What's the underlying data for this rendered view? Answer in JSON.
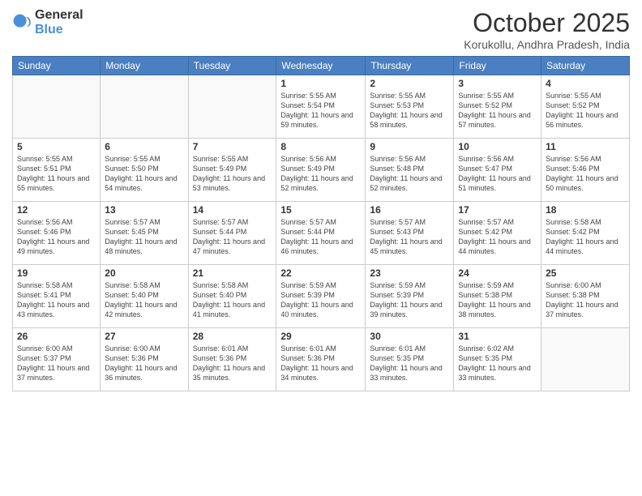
{
  "logo": {
    "general": "General",
    "blue": "Blue"
  },
  "title": "October 2025",
  "subtitle": "Korukollu, Andhra Pradesh, India",
  "weekdays": [
    "Sunday",
    "Monday",
    "Tuesday",
    "Wednesday",
    "Thursday",
    "Friday",
    "Saturday"
  ],
  "weeks": [
    [
      {
        "day": "",
        "info": ""
      },
      {
        "day": "",
        "info": ""
      },
      {
        "day": "",
        "info": ""
      },
      {
        "day": "1",
        "info": "Sunrise: 5:55 AM\nSunset: 5:54 PM\nDaylight: 11 hours\nand 59 minutes."
      },
      {
        "day": "2",
        "info": "Sunrise: 5:55 AM\nSunset: 5:53 PM\nDaylight: 11 hours\nand 58 minutes."
      },
      {
        "day": "3",
        "info": "Sunrise: 5:55 AM\nSunset: 5:52 PM\nDaylight: 11 hours\nand 57 minutes."
      },
      {
        "day": "4",
        "info": "Sunrise: 5:55 AM\nSunset: 5:52 PM\nDaylight: 11 hours\nand 56 minutes."
      }
    ],
    [
      {
        "day": "5",
        "info": "Sunrise: 5:55 AM\nSunset: 5:51 PM\nDaylight: 11 hours\nand 55 minutes."
      },
      {
        "day": "6",
        "info": "Sunrise: 5:55 AM\nSunset: 5:50 PM\nDaylight: 11 hours\nand 54 minutes."
      },
      {
        "day": "7",
        "info": "Sunrise: 5:55 AM\nSunset: 5:49 PM\nDaylight: 11 hours\nand 53 minutes."
      },
      {
        "day": "8",
        "info": "Sunrise: 5:56 AM\nSunset: 5:49 PM\nDaylight: 11 hours\nand 52 minutes."
      },
      {
        "day": "9",
        "info": "Sunrise: 5:56 AM\nSunset: 5:48 PM\nDaylight: 11 hours\nand 52 minutes."
      },
      {
        "day": "10",
        "info": "Sunrise: 5:56 AM\nSunset: 5:47 PM\nDaylight: 11 hours\nand 51 minutes."
      },
      {
        "day": "11",
        "info": "Sunrise: 5:56 AM\nSunset: 5:46 PM\nDaylight: 11 hours\nand 50 minutes."
      }
    ],
    [
      {
        "day": "12",
        "info": "Sunrise: 5:56 AM\nSunset: 5:46 PM\nDaylight: 11 hours\nand 49 minutes."
      },
      {
        "day": "13",
        "info": "Sunrise: 5:57 AM\nSunset: 5:45 PM\nDaylight: 11 hours\nand 48 minutes."
      },
      {
        "day": "14",
        "info": "Sunrise: 5:57 AM\nSunset: 5:44 PM\nDaylight: 11 hours\nand 47 minutes."
      },
      {
        "day": "15",
        "info": "Sunrise: 5:57 AM\nSunset: 5:44 PM\nDaylight: 11 hours\nand 46 minutes."
      },
      {
        "day": "16",
        "info": "Sunrise: 5:57 AM\nSunset: 5:43 PM\nDaylight: 11 hours\nand 45 minutes."
      },
      {
        "day": "17",
        "info": "Sunrise: 5:57 AM\nSunset: 5:42 PM\nDaylight: 11 hours\nand 44 minutes."
      },
      {
        "day": "18",
        "info": "Sunrise: 5:58 AM\nSunset: 5:42 PM\nDaylight: 11 hours\nand 44 minutes."
      }
    ],
    [
      {
        "day": "19",
        "info": "Sunrise: 5:58 AM\nSunset: 5:41 PM\nDaylight: 11 hours\nand 43 minutes."
      },
      {
        "day": "20",
        "info": "Sunrise: 5:58 AM\nSunset: 5:40 PM\nDaylight: 11 hours\nand 42 minutes."
      },
      {
        "day": "21",
        "info": "Sunrise: 5:58 AM\nSunset: 5:40 PM\nDaylight: 11 hours\nand 41 minutes."
      },
      {
        "day": "22",
        "info": "Sunrise: 5:59 AM\nSunset: 5:39 PM\nDaylight: 11 hours\nand 40 minutes."
      },
      {
        "day": "23",
        "info": "Sunrise: 5:59 AM\nSunset: 5:39 PM\nDaylight: 11 hours\nand 39 minutes."
      },
      {
        "day": "24",
        "info": "Sunrise: 5:59 AM\nSunset: 5:38 PM\nDaylight: 11 hours\nand 38 minutes."
      },
      {
        "day": "25",
        "info": "Sunrise: 6:00 AM\nSunset: 5:38 PM\nDaylight: 11 hours\nand 37 minutes."
      }
    ],
    [
      {
        "day": "26",
        "info": "Sunrise: 6:00 AM\nSunset: 5:37 PM\nDaylight: 11 hours\nand 37 minutes."
      },
      {
        "day": "27",
        "info": "Sunrise: 6:00 AM\nSunset: 5:36 PM\nDaylight: 11 hours\nand 36 minutes."
      },
      {
        "day": "28",
        "info": "Sunrise: 6:01 AM\nSunset: 5:36 PM\nDaylight: 11 hours\nand 35 minutes."
      },
      {
        "day": "29",
        "info": "Sunrise: 6:01 AM\nSunset: 5:36 PM\nDaylight: 11 hours\nand 34 minutes."
      },
      {
        "day": "30",
        "info": "Sunrise: 6:01 AM\nSunset: 5:35 PM\nDaylight: 11 hours\nand 33 minutes."
      },
      {
        "day": "31",
        "info": "Sunrise: 6:02 AM\nSunset: 5:35 PM\nDaylight: 11 hours\nand 33 minutes."
      },
      {
        "day": "",
        "info": ""
      }
    ]
  ]
}
